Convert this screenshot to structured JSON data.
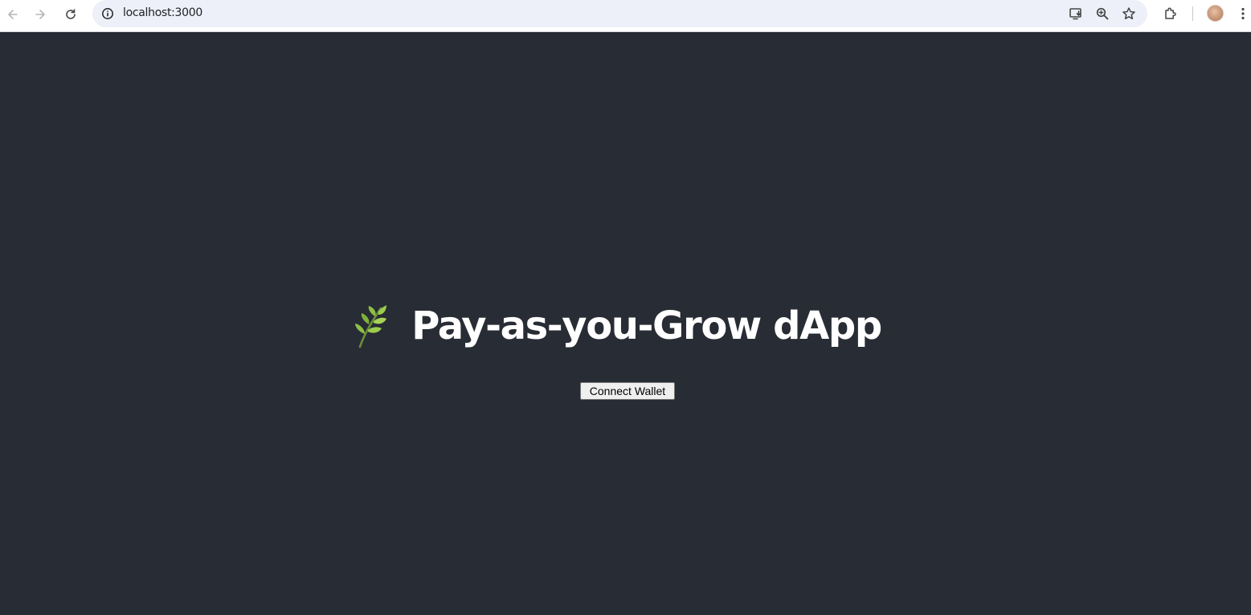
{
  "browser": {
    "url": "localhost:3000",
    "icons": {
      "back": "arrow-left-icon",
      "forward": "arrow-right-icon",
      "reload": "reload-icon",
      "site_info": "info-circle-icon",
      "install": "install-app-icon",
      "zoom": "zoom-icon",
      "bookmark": "star-icon",
      "extensions": "puzzle-icon",
      "menu": "kebab-menu-icon"
    }
  },
  "page": {
    "background": "#282c34",
    "title": "Pay-as-you-Grow dApp",
    "title_icon": "herb-emoji-icon",
    "connect_button": "Connect Wallet"
  }
}
